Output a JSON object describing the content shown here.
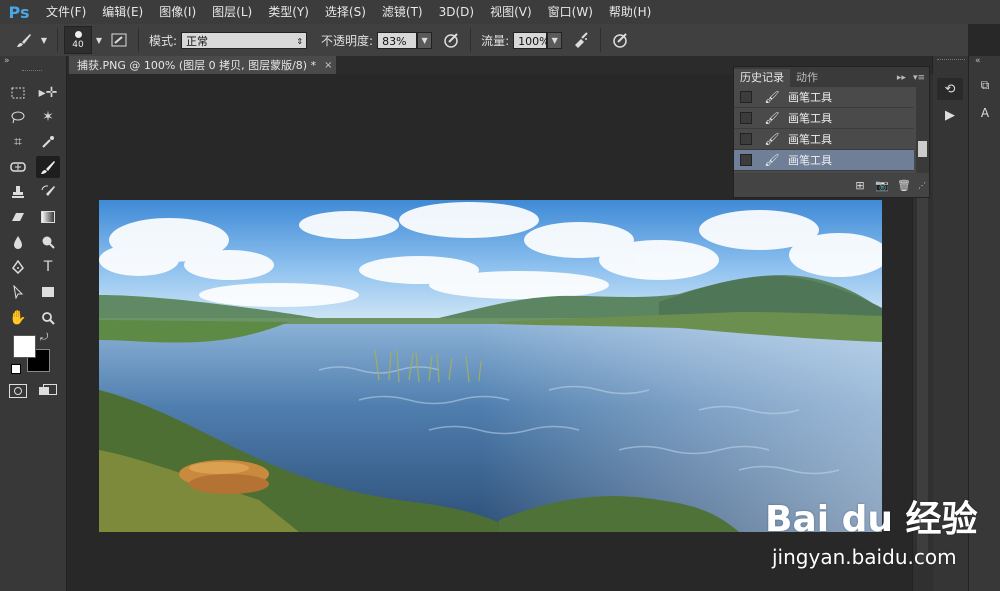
{
  "app": {
    "logo": "Ps"
  },
  "menu": [
    "文件(F)",
    "编辑(E)",
    "图像(I)",
    "图层(L)",
    "类型(Y)",
    "选择(S)",
    "滤镜(T)",
    "3D(D)",
    "视图(V)",
    "窗口(W)",
    "帮助(H)"
  ],
  "options": {
    "brush_size": "40",
    "mode_label": "模式:",
    "mode_value": "正常",
    "opacity_label": "不透明度:",
    "opacity_value": "83%",
    "flow_label": "流量:",
    "flow_value": "100%"
  },
  "document_tab": {
    "title": "捕获.PNG @ 100% (图层 0 拷贝, 图层蒙版/8) *",
    "close": "×"
  },
  "history_panel": {
    "tabs": [
      "历史记录",
      "动作"
    ],
    "items": [
      "画笔工具",
      "画笔工具",
      "画笔工具",
      "画笔工具"
    ],
    "selected_index": 3
  },
  "watermark": {
    "logo": "Bai du 经验",
    "url": "jingyan.baidu.com"
  },
  "colors": {
    "accent": "#4aa6e8",
    "selection": "#6f7f97",
    "foreground": "#ffffff",
    "background": "#000000"
  }
}
